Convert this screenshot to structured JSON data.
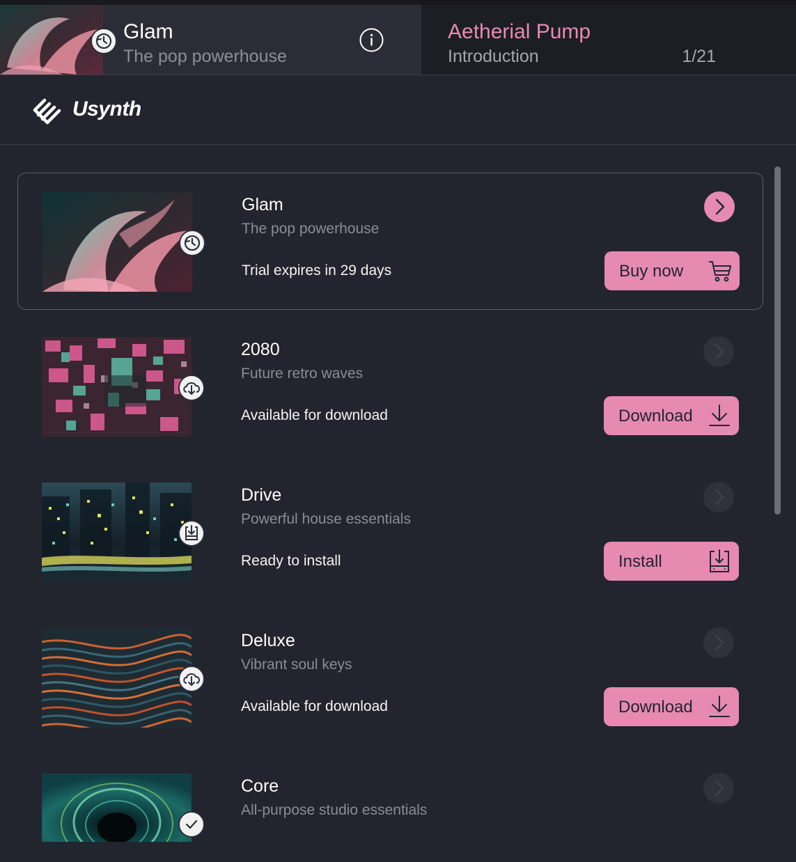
{
  "header": {
    "product_title": "Glam",
    "product_subtitle": "The pop powerhouse",
    "preset_name": "Aetherial Pump",
    "preset_section": "Introduction",
    "preset_counter": "1/21"
  },
  "brand": {
    "name": "Usynth"
  },
  "colors": {
    "accent": "#e68ab2",
    "background": "#22252e",
    "header_bg": "#2a2d36"
  },
  "products": [
    {
      "name": "Glam",
      "tagline": "The pop powerhouse",
      "status": "Trial expires in 29 days",
      "action_label": "Buy now",
      "action_icon": "cart-icon",
      "badge_icon": "clock-icon"
    },
    {
      "name": "2080",
      "tagline": "Future retro waves",
      "status": "Available for download",
      "action_label": "Download",
      "action_icon": "download-icon",
      "badge_icon": "cloud-download-icon"
    },
    {
      "name": "Drive",
      "tagline": "Powerful house essentials",
      "status": "Ready to install",
      "action_label": "Install",
      "action_icon": "install-icon",
      "badge_icon": "install-icon"
    },
    {
      "name": "Deluxe",
      "tagline": "Vibrant soul keys",
      "status": "Available for download",
      "action_label": "Download",
      "action_icon": "download-icon",
      "badge_icon": "cloud-download-icon"
    },
    {
      "name": "Core",
      "tagline": "All-purpose studio essentials",
      "status": "",
      "action_label": "",
      "action_icon": "",
      "badge_icon": "check-icon"
    }
  ]
}
